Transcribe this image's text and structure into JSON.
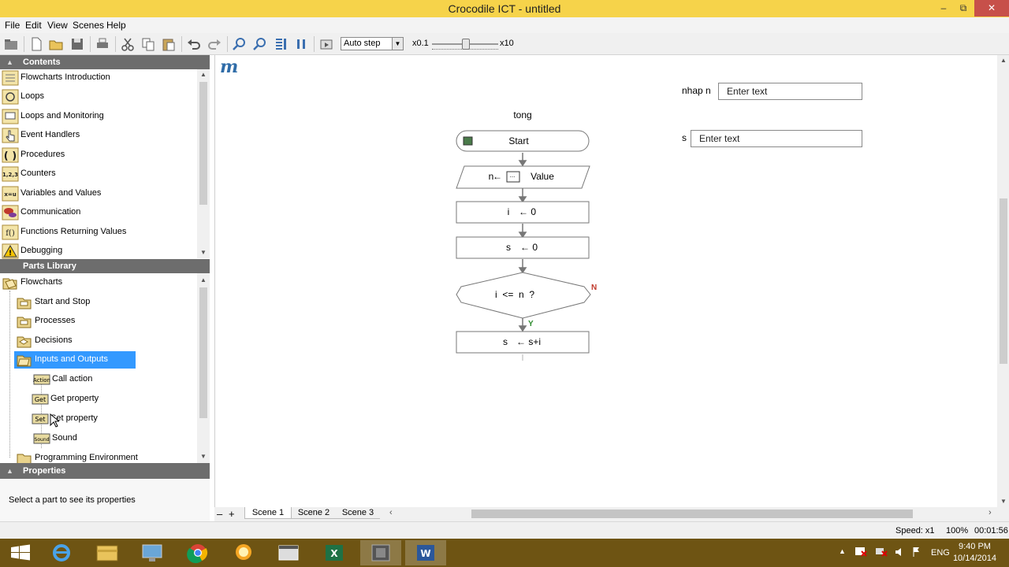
{
  "window": {
    "title": "Crocodile ICT - untitled",
    "minimize": "–",
    "restore": "⧉",
    "close": "✕"
  },
  "menu": {
    "file": "File",
    "edit": "Edit",
    "view": "View",
    "scenes": "Scenes",
    "help": "Help"
  },
  "toolbar": {
    "step_mode": "Auto step",
    "speed_min": "x0.1",
    "speed_max": "x10",
    "speed_level": 0.5
  },
  "contents": {
    "header": "Contents",
    "items": [
      {
        "label": "Flowcharts Introduction",
        "icon": "flowchart-icon"
      },
      {
        "label": "Loops",
        "icon": "loop-icon"
      },
      {
        "label": "Loops and Monitoring",
        "icon": "loop-monitor-icon"
      },
      {
        "label": "Event Handlers",
        "icon": "pointer-hand-icon"
      },
      {
        "label": "Procedures",
        "icon": "parentheses-icon"
      },
      {
        "label": "Counters",
        "icon": "counter-icon"
      },
      {
        "label": "Variables and Values",
        "icon": "variable-icon"
      },
      {
        "label": "Communication",
        "icon": "speech-bubble-icon"
      },
      {
        "label": "Functions Returning Values",
        "icon": "function-icon"
      },
      {
        "label": "Debugging",
        "icon": "warning-icon"
      }
    ]
  },
  "parts_library": {
    "header": "Parts Library",
    "root": "Flowcharts",
    "folders": [
      "Start and Stop",
      "Processes",
      "Decisions",
      "Inputs and Outputs"
    ],
    "selected": "Inputs and Outputs",
    "children": [
      {
        "label": "Call action",
        "badge": "Action"
      },
      {
        "label": "Get property",
        "badge": "Get"
      },
      {
        "label": "Set property",
        "badge": "Set"
      },
      {
        "label": "Sound",
        "badge": "Sound"
      }
    ],
    "next_folder": "Programming Environment"
  },
  "properties": {
    "header": "Properties",
    "hint": "Select a part to see its properties"
  },
  "canvas": {
    "logo": "m",
    "flowchart_title": "tong",
    "start": "Start",
    "input": {
      "var": "n",
      "arrow": "←",
      "value": "Value"
    },
    "assign1": {
      "var": "i",
      "expr": "← 0"
    },
    "assign2": {
      "var": "s",
      "expr": "← 0"
    },
    "decision": {
      "text": "i  <=  n  ?",
      "no": "N",
      "yes": "Y"
    },
    "assign3": {
      "var": "s",
      "expr": "← s+i"
    },
    "field1": {
      "label": "nhap n",
      "placeholder": "Enter text"
    },
    "field2": {
      "label": "s",
      "placeholder": "Enter text"
    }
  },
  "scenes": {
    "minus": "–",
    "plus": "+",
    "tabs": [
      "Scene 1",
      "Scene 2",
      "Scene 3"
    ],
    "active": "Scene 1"
  },
  "status": {
    "speed": "Speed: x1",
    "zoom": "100%",
    "time": "00:01:56"
  },
  "taskbar": {
    "lang": "ENG",
    "time": "9:40 PM",
    "date": "10/14/2014",
    "apps": [
      "file-explorer-icon",
      "internet-explorer-icon",
      "folder-icon",
      "computer-icon",
      "chrome-icon",
      "crocodile-icon",
      "window-icon",
      "excel-icon",
      "media-icon",
      "word-icon"
    ]
  },
  "colors": {
    "titlebar": "#f6d34a",
    "panel_header": "#6d6d6d",
    "selection": "#3399ff",
    "taskbar": "#6e5413",
    "decision_no": "#c0392b",
    "decision_yes": "#2e8b2e"
  }
}
